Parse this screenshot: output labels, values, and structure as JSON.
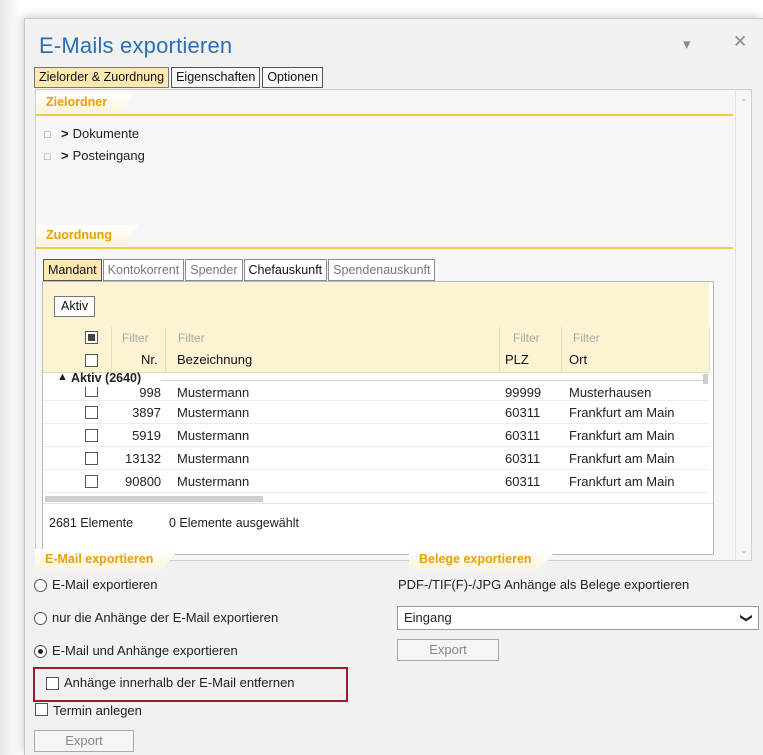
{
  "window": {
    "title": "E-Mails exportieren",
    "min_icon": "chevron-down-icon",
    "close_icon": "close-icon"
  },
  "top_tabs": [
    {
      "label": "Zielorder & Zuordnung",
      "active": true
    },
    {
      "label": "Eigenschaften",
      "active": false
    },
    {
      "label": "Optionen",
      "active": false
    }
  ],
  "zielordner": {
    "heading": "Zielordner",
    "items": [
      {
        "label": "Dokumente",
        "icon": "folder-stack-icon"
      },
      {
        "label": "Posteingang",
        "icon": "inbox-folder-icon"
      }
    ]
  },
  "zuordnung": {
    "heading": "Zuordnung",
    "tabs": [
      {
        "label": "Mandant",
        "active": true
      },
      {
        "label": "Kontokorrent",
        "active": false
      },
      {
        "label": "Spender",
        "active": false
      },
      {
        "label": "Chefauskunft",
        "active": false
      },
      {
        "label": "Spendenauskunft",
        "active": false
      }
    ],
    "aktiv_button": "Aktiv",
    "filter_labels": [
      "Filter",
      "Filter",
      "Filter",
      "Filter"
    ],
    "columns": [
      "Nr.",
      "Bezeichnung",
      "PLZ",
      "Ort"
    ],
    "group_label": "Aktiv (2640)",
    "rows": [
      {
        "nr": "998",
        "bezeichnung": "Mustermann",
        "plz": "99999",
        "ort": "Musterhausen"
      },
      {
        "nr": "3897",
        "bezeichnung": "Mustermann",
        "plz": "60311",
        "ort": "Frankfurt am Main"
      },
      {
        "nr": "5919",
        "bezeichnung": "Mustermann",
        "plz": "60311",
        "ort": "Frankfurt am Main"
      },
      {
        "nr": "13132",
        "bezeichnung": "Mustermann",
        "plz": "60311",
        "ort": "Frankfurt am Main"
      },
      {
        "nr": "90800",
        "bezeichnung": "Mustermann",
        "plz": "60311",
        "ort": "Frankfurt am Main"
      }
    ],
    "status_count": "2681 Elemente",
    "status_selected": "0 Elemente ausgewählt"
  },
  "email_export": {
    "heading": "E-Mail exportieren",
    "options": [
      {
        "label": "E-Mail exportieren",
        "selected": false
      },
      {
        "label": "nur die Anhänge der E-Mail exportieren",
        "selected": false
      },
      {
        "label": "E-Mail und Anhänge exportieren",
        "selected": true
      }
    ],
    "checkbox_remove": "Anhänge innerhalb der E-Mail entfernen",
    "checkbox_termin": "Termin anlegen",
    "export_button": "Export"
  },
  "belege_export": {
    "heading": "Belege exportieren",
    "description": "PDF-/TIF(F)-/JPG Anhänge als Belege exportieren",
    "select_value": "Eingang",
    "export_button": "Export"
  },
  "colors": {
    "title": "#2a6fb5",
    "section_heading": "#e8a100",
    "active_tab": "#fde9b0",
    "highlight": "#9b1c2e"
  }
}
